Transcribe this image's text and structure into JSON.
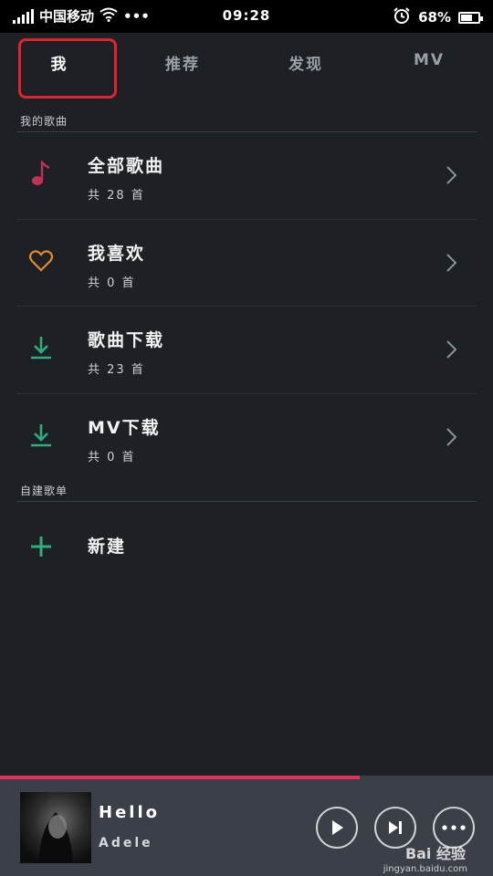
{
  "status_bar": {
    "carrier": "中国移动",
    "dots": "•••",
    "time": "09:28",
    "battery": "68%",
    "battery_level": 0.68
  },
  "tabs": [
    {
      "label": "我",
      "active": true
    },
    {
      "label": "推荐",
      "active": false
    },
    {
      "label": "发现",
      "active": false
    },
    {
      "label": "MV",
      "active": false
    }
  ],
  "my_music": {
    "section_label": "我的歌曲",
    "items": [
      {
        "title": "全部歌曲",
        "subtitle": "共 28 首",
        "icon": "music-note-icon",
        "color": "#c2305a"
      },
      {
        "title": "我喜欢",
        "subtitle": "共 0 首",
        "icon": "heart-icon",
        "color": "#e08a2c"
      },
      {
        "title": "歌曲下载",
        "subtitle": "共 23 首",
        "icon": "download-icon",
        "color": "#2fae7a"
      },
      {
        "title": "MV下载",
        "subtitle": "共 0 首",
        "icon": "download-icon",
        "color": "#2fae7a"
      }
    ]
  },
  "playlists": {
    "section_label": "自建歌单",
    "new_label": "新建"
  },
  "player": {
    "song": "Hello",
    "artist": "Adele",
    "progress": 0.73,
    "accent": "#e0325a"
  },
  "watermark": {
    "text": "Bai 经验",
    "sub": "jingyan.baidu.com"
  }
}
